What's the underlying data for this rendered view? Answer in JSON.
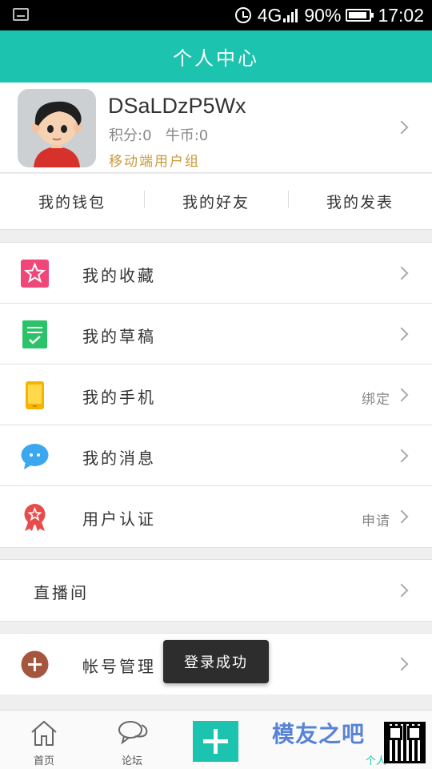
{
  "status_bar": {
    "network": "4G",
    "signal_tag": "4G",
    "battery": "90%",
    "time": "17:02"
  },
  "header": {
    "title": "个人中心"
  },
  "profile": {
    "username": "DSaLDzP5Wx",
    "points": "积分:0",
    "coins": "牛币:0",
    "group": "移动端用户组"
  },
  "shortcuts": [
    "我的钱包",
    "我的好友",
    "我的发表"
  ],
  "menu": [
    {
      "label": "我的收藏",
      "icon": "star-icon",
      "extra": ""
    },
    {
      "label": "我的草稿",
      "icon": "draft-icon",
      "extra": ""
    },
    {
      "label": "我的手机",
      "icon": "phone-icon",
      "extra": "绑定"
    },
    {
      "label": "我的消息",
      "icon": "message-icon",
      "extra": ""
    },
    {
      "label": "用户认证",
      "icon": "badge-icon",
      "extra": "申请"
    }
  ],
  "live": {
    "label": "直播间"
  },
  "account": {
    "label": "帐号管理",
    "icon": "plus-circle-icon"
  },
  "toast": {
    "text": "登录成功"
  },
  "tabbar": {
    "home": "首页",
    "forum": "论坛",
    "watermark": "模友之吧",
    "profile": "个人"
  },
  "colors": {
    "accent": "#1cc3ae",
    "star": "#f0477a",
    "draft": "#2bc26a",
    "phone": "#f5b400",
    "message": "#3aa7ee",
    "badge": "#e94b4b",
    "account": "#a5563f"
  }
}
